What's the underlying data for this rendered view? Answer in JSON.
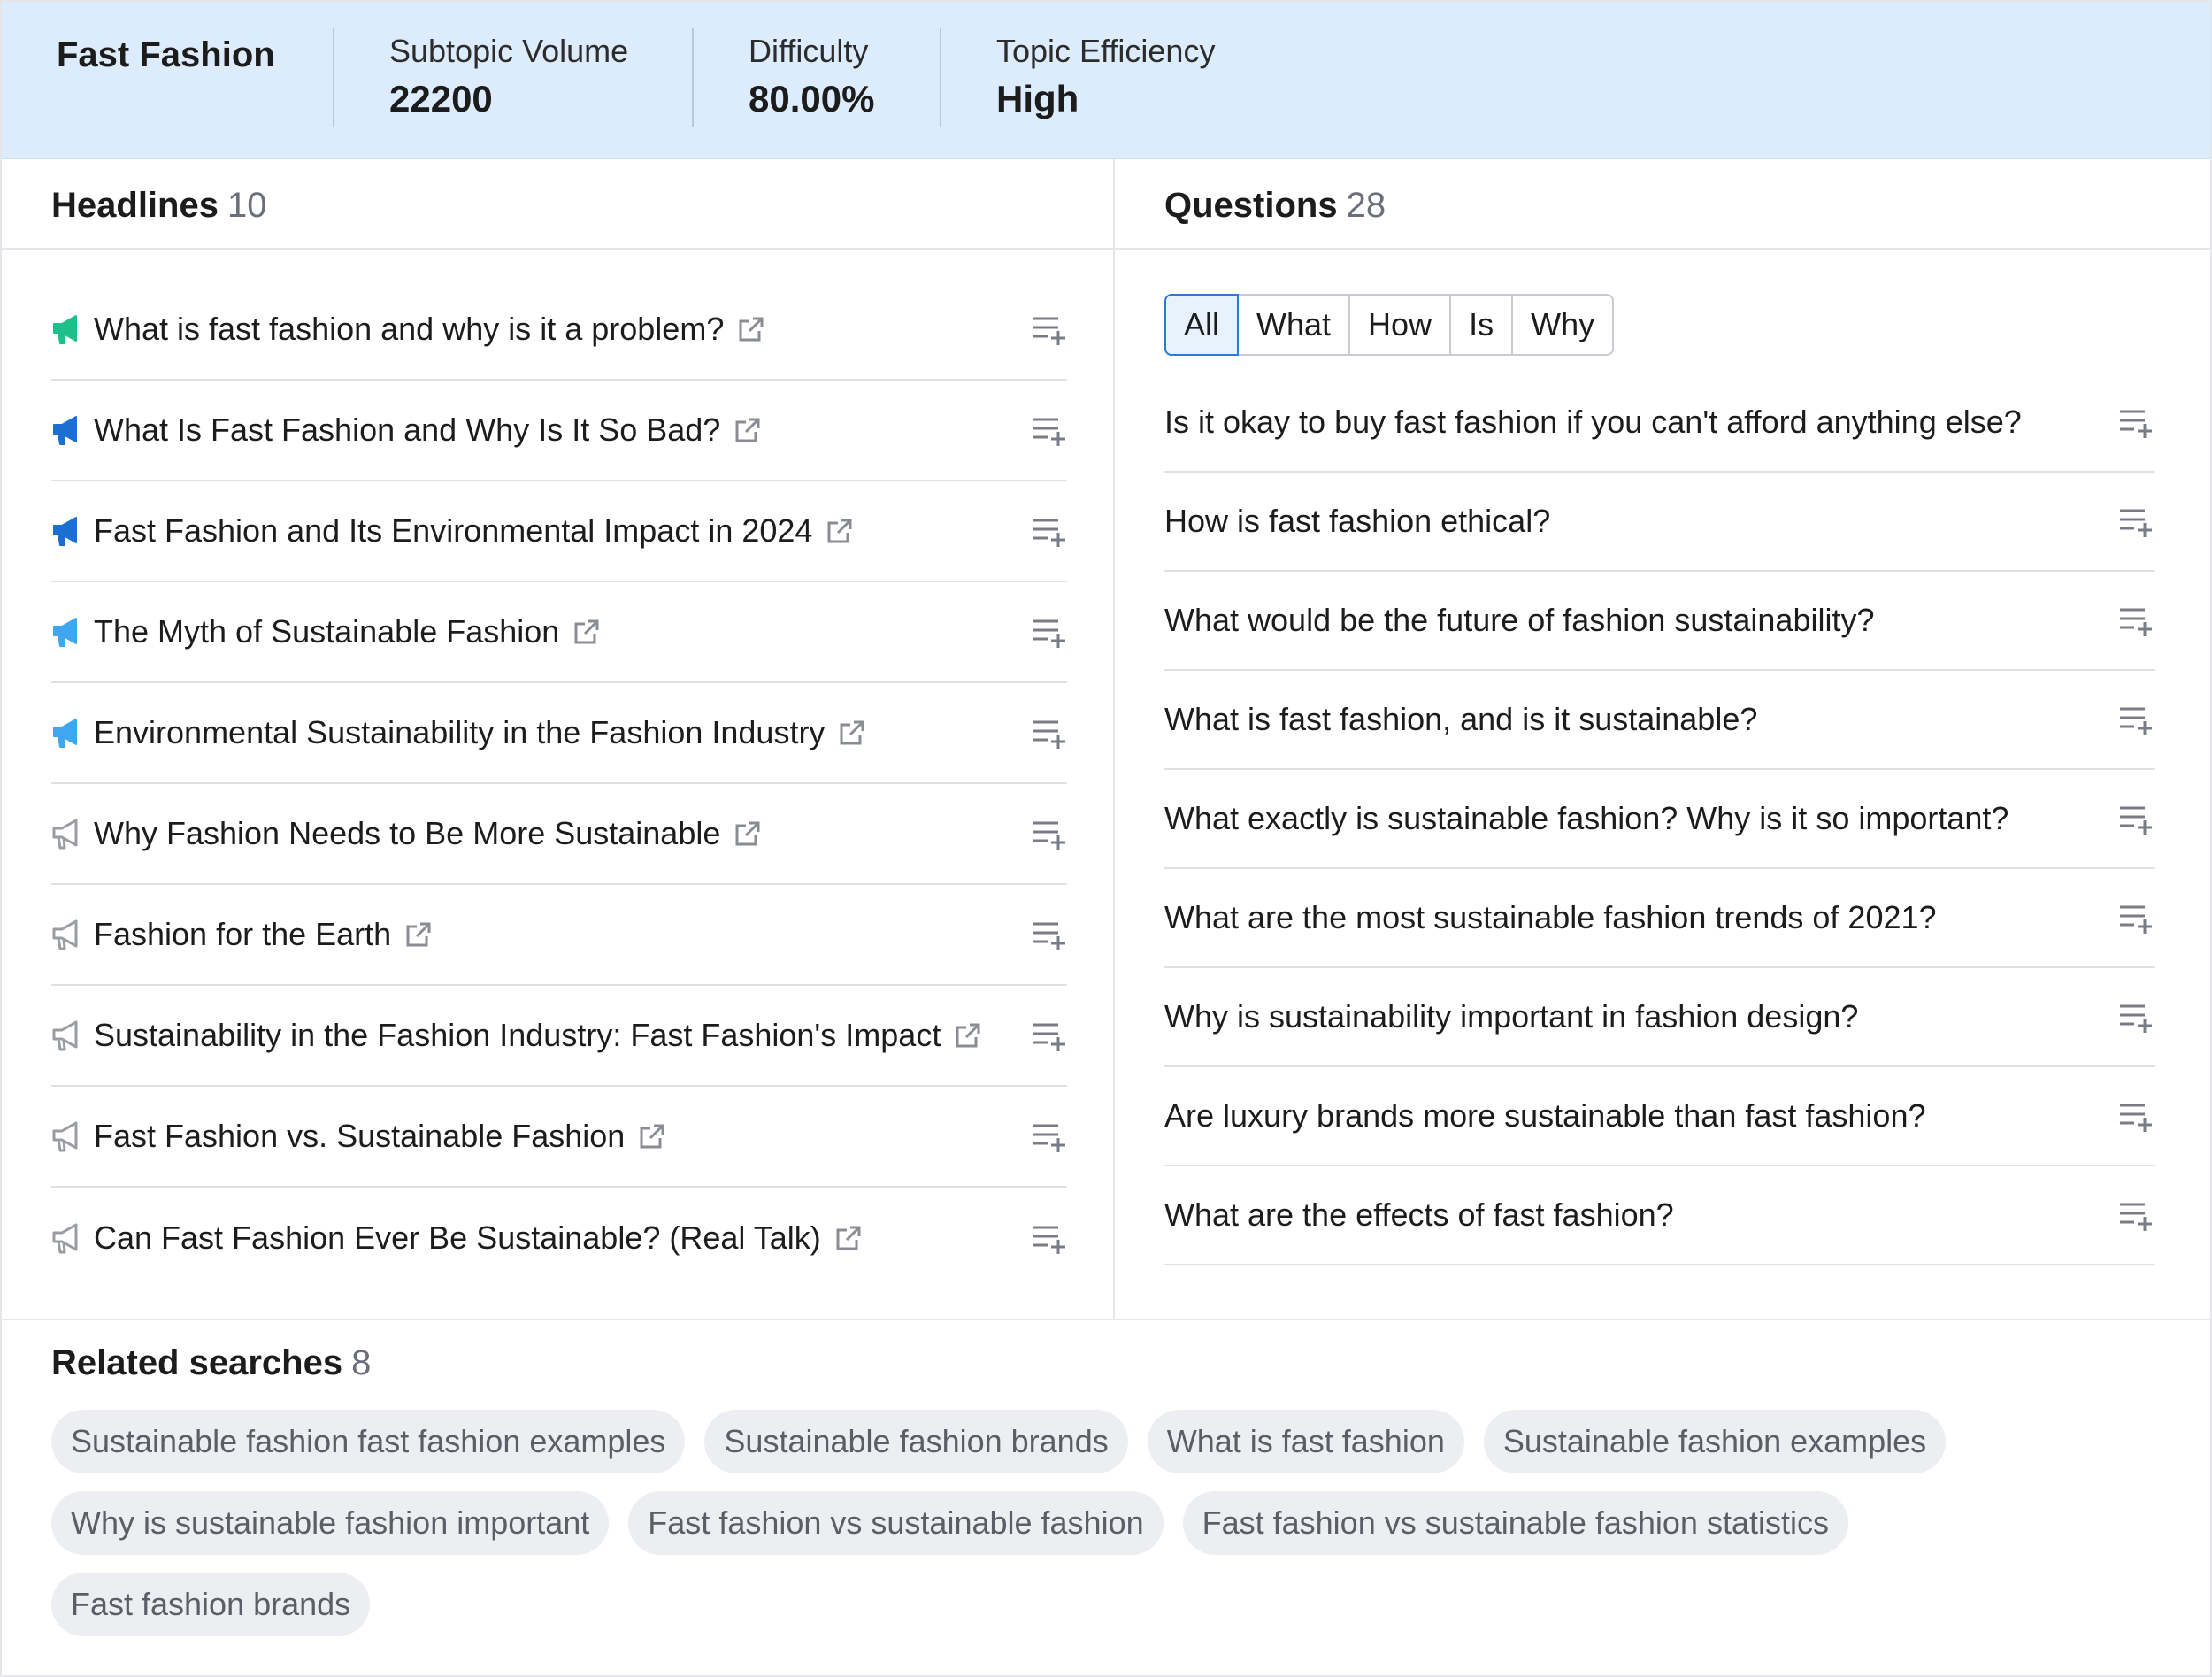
{
  "header": {
    "topic": "Fast Fashion",
    "metrics": [
      {
        "label": "Subtopic Volume",
        "value": "22200"
      },
      {
        "label": "Difficulty",
        "value": "80.00%"
      },
      {
        "label": "Topic Efficiency",
        "value": "High"
      }
    ]
  },
  "headlines": {
    "title": "Headlines",
    "count": "10",
    "items": [
      {
        "text": "What is fast fashion and why is it a problem?",
        "icon_color": "#1ec08a"
      },
      {
        "text": "What Is Fast Fashion and Why Is It So Bad?",
        "icon_color": "#1a6fd1"
      },
      {
        "text": "Fast Fashion and Its Environmental Impact in 2024",
        "icon_color": "#1a6fd1"
      },
      {
        "text": "The Myth of Sustainable Fashion",
        "icon_color": "#3fa6f0"
      },
      {
        "text": "Environmental Sustainability in the Fashion Industry",
        "icon_color": "#3fa6f0"
      },
      {
        "text": "Why Fashion Needs to Be More Sustainable",
        "icon_color": "#9a9ca4"
      },
      {
        "text": "Fashion for the Earth",
        "icon_color": "#9a9ca4"
      },
      {
        "text": "Sustainability in the Fashion Industry: Fast Fashion's Impact",
        "icon_color": "#9a9ca4"
      },
      {
        "text": "Fast Fashion vs. Sustainable Fashion",
        "icon_color": "#9a9ca4"
      },
      {
        "text": "Can Fast Fashion Ever Be Sustainable? (Real Talk)",
        "icon_color": "#9a9ca4"
      }
    ]
  },
  "questions": {
    "title": "Questions",
    "count": "28",
    "filters": [
      "All",
      "What",
      "How",
      "Is",
      "Why"
    ],
    "active_filter": "All",
    "items": [
      "Is it okay to buy fast fashion if you can't afford anything else?",
      "How is fast fashion ethical?",
      "What would be the future of fashion sustainability?",
      "What is fast fashion, and is it sustainable?",
      "What exactly is sustainable fashion? Why is it so important?",
      "What are the most sustainable fashion trends of 2021?",
      "Why is sustainability important in fashion design?",
      "Are luxury brands more sustainable than fast fashion?",
      "What are the effects of fast fashion?"
    ]
  },
  "related": {
    "title": "Related searches",
    "count": "8",
    "rows": [
      [
        "Sustainable fashion fast fashion examples",
        "Sustainable fashion brands",
        "What is fast fashion",
        "Sustainable fashion examples"
      ],
      [
        "Why is sustainable fashion important",
        "Fast fashion vs sustainable fashion",
        "Fast fashion vs sustainable fashion statistics"
      ],
      [
        "Fast fashion brands"
      ]
    ]
  },
  "colors": {
    "header_bg": "#dcecfc",
    "active_filter_border": "#2b7bd4",
    "chip_bg": "#eceef1",
    "icon_gray": "#8a8c94"
  }
}
